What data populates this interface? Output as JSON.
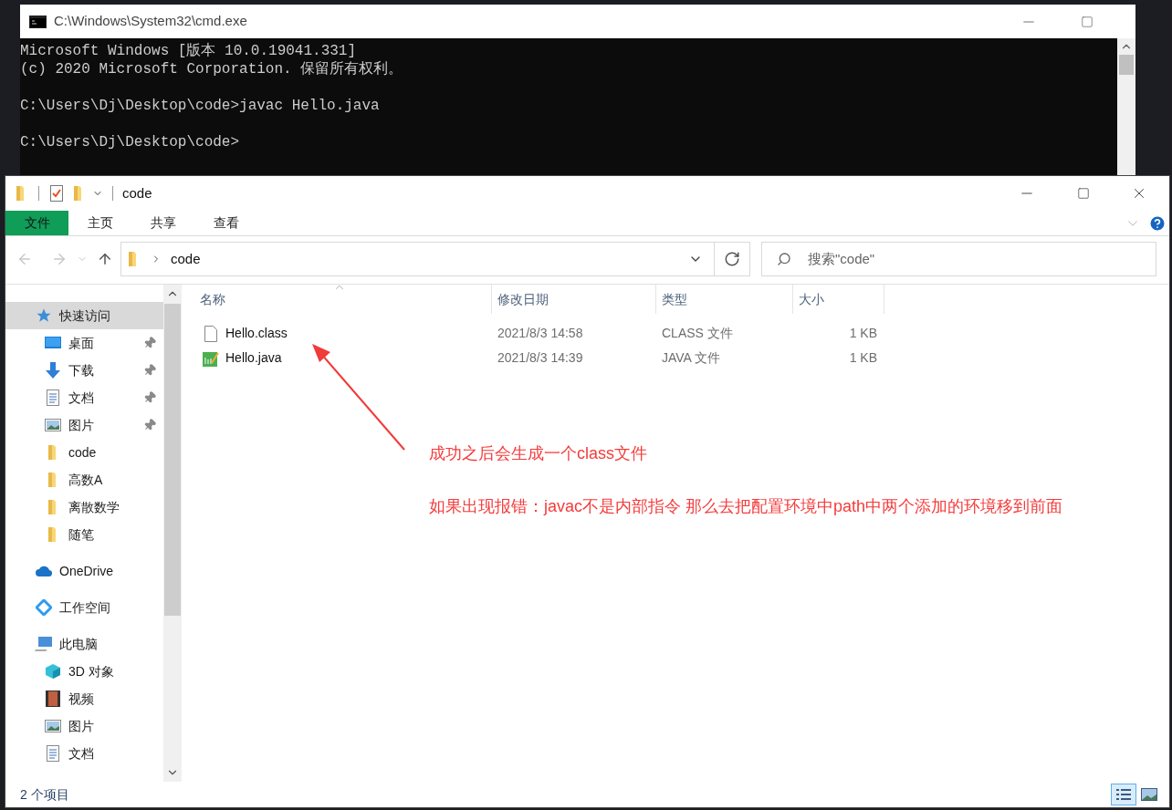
{
  "cmd": {
    "title": "C:\\Windows\\System32\\cmd.exe",
    "paragraphs": [
      [
        "Microsoft Windows [版本 10.0.19041.331]",
        "(c) 2020 Microsoft Corporation. 保留所有权利。"
      ],
      [
        "C:\\Users\\Dj\\Desktop\\code>javac Hello.java"
      ],
      [
        "C:\\Users\\Dj\\Desktop\\code>"
      ]
    ]
  },
  "explorer": {
    "title": "code",
    "ribbon_tabs": [
      {
        "label": "文件",
        "selected": true
      },
      {
        "label": "主页",
        "selected": false
      },
      {
        "label": "共享",
        "selected": false
      },
      {
        "label": "查看",
        "selected": false
      }
    ],
    "address": {
      "crumb": "code"
    },
    "search": {
      "placeholder": "搜索\"code\""
    },
    "nav": [
      {
        "label": "快速访问",
        "kind": "star",
        "selected": true,
        "children": [
          {
            "label": "桌面",
            "kind": "desktop",
            "pinned": true,
            "selected": false
          },
          {
            "label": "下载",
            "kind": "download",
            "pinned": true,
            "selected": false
          },
          {
            "label": "文档",
            "kind": "document",
            "pinned": true,
            "selected": false
          },
          {
            "label": "图片",
            "kind": "picture",
            "pinned": true,
            "selected": false
          },
          {
            "label": "code",
            "kind": "folder",
            "pinned": false,
            "selected": false
          },
          {
            "label": "高数A",
            "kind": "folder",
            "pinned": false,
            "selected": false
          },
          {
            "label": "离散数学",
            "kind": "folder",
            "pinned": false,
            "selected": false
          },
          {
            "label": "随笔",
            "kind": "folder",
            "pinned": false,
            "selected": false
          }
        ]
      },
      {
        "label": "OneDrive",
        "kind": "cloud",
        "selected": false
      },
      {
        "label": "工作空间",
        "kind": "workspace",
        "selected": false
      },
      {
        "label": "此电脑",
        "kind": "computer",
        "selected": false,
        "children": [
          {
            "label": "3D 对象",
            "kind": "cube",
            "pinned": false,
            "selected": false
          },
          {
            "label": "视频",
            "kind": "video",
            "pinned": false,
            "selected": false
          },
          {
            "label": "图片",
            "kind": "picture",
            "pinned": false,
            "selected": false
          },
          {
            "label": "文档",
            "kind": "document",
            "pinned": false,
            "selected": false
          }
        ]
      }
    ],
    "columns": [
      "名称",
      "修改日期",
      "类型",
      "大小"
    ],
    "files": [
      {
        "name": "Hello.class",
        "kind": "blank",
        "modified": "2021/8/3 14:58",
        "type": "CLASS 文件",
        "size": "1 KB"
      },
      {
        "name": "Hello.java",
        "kind": "java",
        "modified": "2021/8/3 14:39",
        "type": "JAVA 文件",
        "size": "1 KB"
      }
    ],
    "status": "2 个项目",
    "views": [
      {
        "kind": "details",
        "selected": true
      },
      {
        "kind": "tiles",
        "selected": false
      }
    ]
  },
  "annotations": [
    "成功之后会生成一个class文件",
    "如果出现报错：javac不是内部指令 那么去把配置环境中path中两个添加的环境移到前面"
  ]
}
